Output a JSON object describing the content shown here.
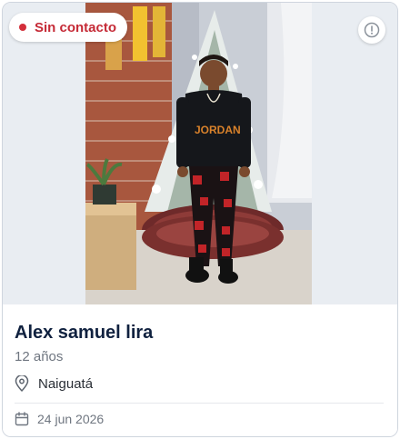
{
  "card": {
    "status": {
      "label": "Sin contacto",
      "color": "#d32f3a"
    },
    "info_button": {
      "icon": "alert-circle-icon"
    },
    "photo": {
      "description_icon": "person-photo"
    },
    "person": {
      "name": "Alex samuel lira",
      "age": "12 años",
      "location": "Naiguatá",
      "date": "24 jun 2026"
    },
    "icons": {
      "location": "map-pin-icon",
      "date": "calendar-icon"
    }
  }
}
